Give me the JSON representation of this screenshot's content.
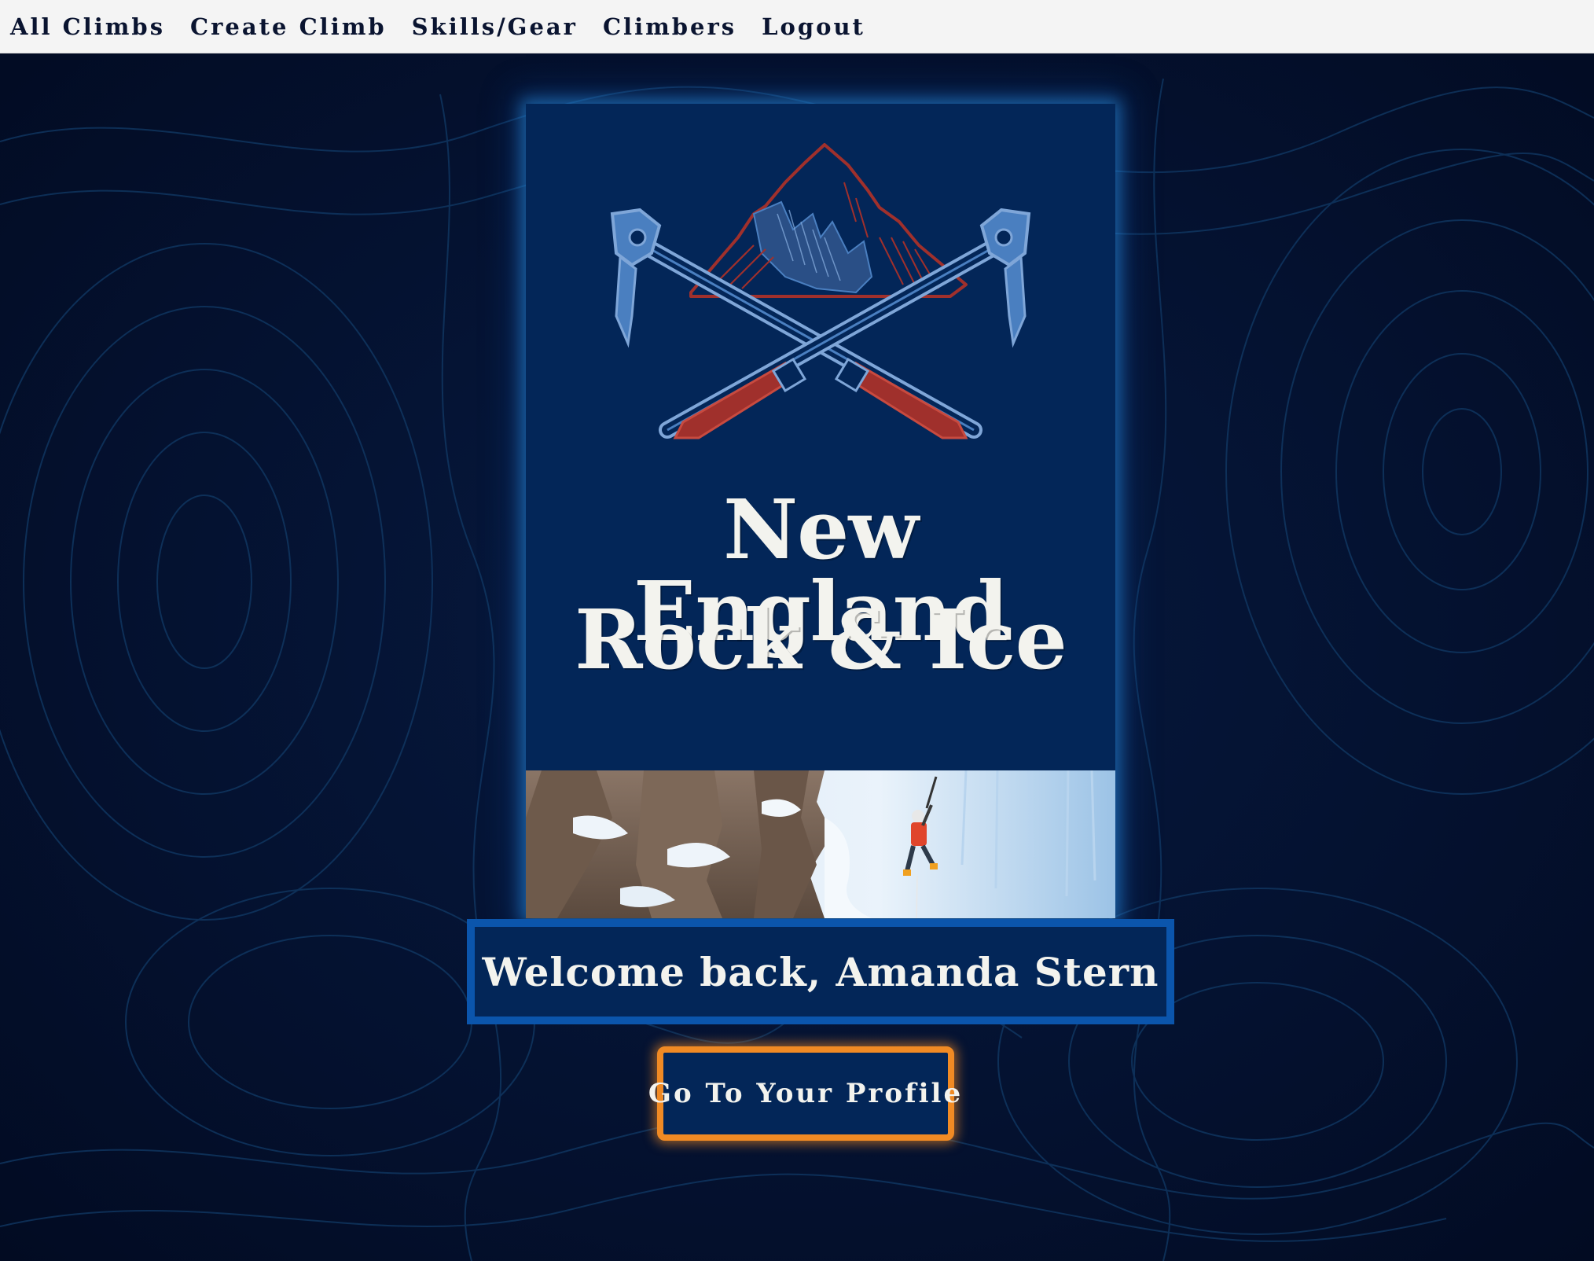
{
  "nav": {
    "links": [
      {
        "label": "All Climbs"
      },
      {
        "label": "Create Climb"
      },
      {
        "label": "Skills/Gear"
      },
      {
        "label": "Climbers"
      },
      {
        "label": "Logout"
      }
    ]
  },
  "poster": {
    "logo_icon": "crossed-ice-axes-mountain-icon",
    "title_line1": "New England",
    "title_line2": "Rock & Ice",
    "photo_subject": "ice-climber-photo"
  },
  "welcome": {
    "text": "Welcome back, Amanda Stern"
  },
  "profile_button": {
    "label": "Go To Your Profile"
  },
  "colors": {
    "background": "#04112f",
    "poster": "#032658",
    "welcome_border": "#0b55ac",
    "button_border": "#f08a24",
    "logo_red": "#a0302c",
    "logo_blue": "#4a7fc0",
    "text": "#f3f3ee"
  }
}
